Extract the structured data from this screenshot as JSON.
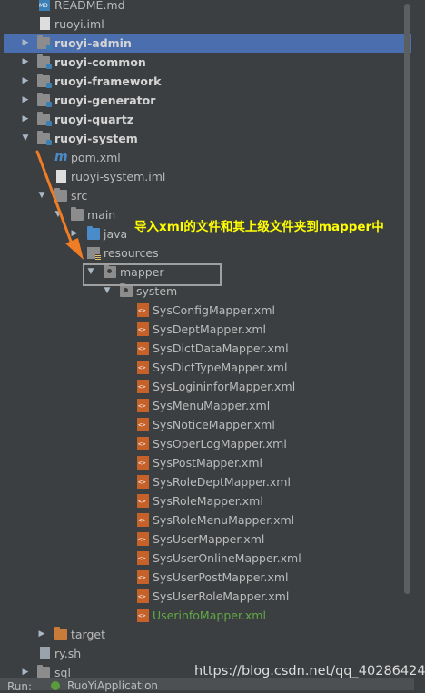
{
  "tree": {
    "items": [
      {
        "label": "README.md",
        "icon": "md-file-icon"
      },
      {
        "label": "ruoyi.iml",
        "icon": "iml-file-icon"
      },
      {
        "label": "ruoyi-admin",
        "icon": "module-folder-icon"
      },
      {
        "label": "ruoyi-common",
        "icon": "module-folder-icon"
      },
      {
        "label": "ruoyi-framework",
        "icon": "module-folder-icon"
      },
      {
        "label": "ruoyi-generator",
        "icon": "module-folder-icon"
      },
      {
        "label": "ruoyi-quartz",
        "icon": "module-folder-icon"
      },
      {
        "label": "ruoyi-system",
        "icon": "module-folder-icon"
      },
      {
        "label": "pom.xml",
        "icon": "maven-file-icon"
      },
      {
        "label": "ruoyi-system.iml",
        "icon": "iml-file-icon"
      },
      {
        "label": "src",
        "icon": "folder-icon"
      },
      {
        "label": "main",
        "icon": "folder-icon"
      },
      {
        "label": "java",
        "icon": "source-folder-icon"
      },
      {
        "label": "resources",
        "icon": "resources-folder-icon"
      },
      {
        "label": "mapper",
        "icon": "package-folder-icon"
      },
      {
        "label": "system",
        "icon": "package-folder-icon"
      },
      {
        "label": "SysConfigMapper.xml",
        "icon": "xml-file-icon"
      },
      {
        "label": "SysDeptMapper.xml",
        "icon": "xml-file-icon"
      },
      {
        "label": "SysDictDataMapper.xml",
        "icon": "xml-file-icon"
      },
      {
        "label": "SysDictTypeMapper.xml",
        "icon": "xml-file-icon"
      },
      {
        "label": "SysLogininforMapper.xml",
        "icon": "xml-file-icon"
      },
      {
        "label": "SysMenuMapper.xml",
        "icon": "xml-file-icon"
      },
      {
        "label": "SysNoticeMapper.xml",
        "icon": "xml-file-icon"
      },
      {
        "label": "SysOperLogMapper.xml",
        "icon": "xml-file-icon"
      },
      {
        "label": "SysPostMapper.xml",
        "icon": "xml-file-icon"
      },
      {
        "label": "SysRoleDeptMapper.xml",
        "icon": "xml-file-icon"
      },
      {
        "label": "SysRoleMapper.xml",
        "icon": "xml-file-icon"
      },
      {
        "label": "SysRoleMenuMapper.xml",
        "icon": "xml-file-icon"
      },
      {
        "label": "SysUserMapper.xml",
        "icon": "xml-file-icon"
      },
      {
        "label": "SysUserOnlineMapper.xml",
        "icon": "xml-file-icon"
      },
      {
        "label": "SysUserPostMapper.xml",
        "icon": "xml-file-icon"
      },
      {
        "label": "SysUserRoleMapper.xml",
        "icon": "xml-file-icon"
      },
      {
        "label": "UserinfoMapper.xml",
        "icon": "xml-file-icon"
      },
      {
        "label": "target",
        "icon": "excluded-folder-icon"
      },
      {
        "label": "ry.sh",
        "icon": "shell-file-icon"
      },
      {
        "label": "sql",
        "icon": "folder-icon"
      }
    ]
  },
  "annotation": {
    "text": "导入xml的文件和其上级文件夹到mapper中",
    "color": "#ffff00",
    "arrow_color": "#f07c24"
  },
  "bottom": {
    "run_label": "Run:",
    "app_tab": "RuoYiApplication"
  },
  "watermark": "https://blog.csdn.net/qq_40286424",
  "colors": {
    "background": "#3c3f41",
    "selection": "#4b6eaf",
    "new_file_green": "#62a845",
    "xml_icon": "#c7612a"
  }
}
